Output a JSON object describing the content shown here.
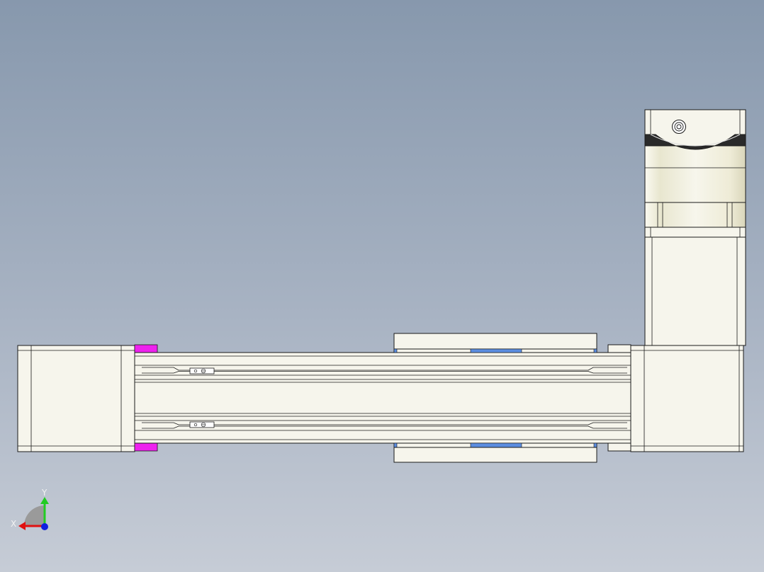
{
  "triad": {
    "x_label": "X",
    "y_label": "Y"
  },
  "colors": {
    "part_fill": "#f6f5ec",
    "edge": "#1a1a1a",
    "bumper_magenta": "#ee22ee",
    "carriage_blue": "#5b8de0",
    "axis_x": "#e01010",
    "axis_y": "#22cc22",
    "axis_z": "#1020e0"
  }
}
